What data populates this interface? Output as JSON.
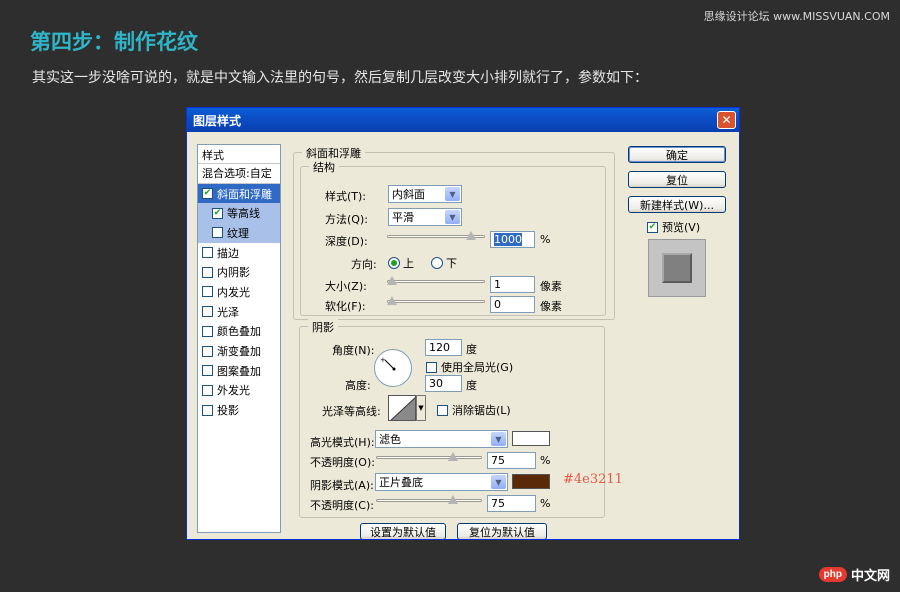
{
  "page": {
    "watermark": "思缘设计论坛 www.MISSVUAN.COM",
    "heading": "第四步：制作花纹",
    "intro": "其实这一步没啥可说的，就是中文输入法里的句号，然后复制几层改变大小排列就行了，参数如下：",
    "color_note": "#4e3211",
    "color_note_color": "#e05a4a",
    "logo_badge": "php",
    "logo_text": "中文网"
  },
  "dialog": {
    "title": "图层样式",
    "close": "✕",
    "styles_header": "样式",
    "blend_options": "混合选项:自定",
    "style_items": [
      {
        "label": "斜面和浮雕",
        "checked": true
      },
      {
        "label": "等高线",
        "checked": true
      },
      {
        "label": "纹理",
        "checked": false
      },
      {
        "label": "描边",
        "checked": false
      },
      {
        "label": "内阴影",
        "checked": false
      },
      {
        "label": "内发光",
        "checked": false
      },
      {
        "label": "光泽",
        "checked": false
      },
      {
        "label": "颜色叠加",
        "checked": false
      },
      {
        "label": "渐变叠加",
        "checked": false
      },
      {
        "label": "图案叠加",
        "checked": false
      },
      {
        "label": "外发光",
        "checked": false
      },
      {
        "label": "投影",
        "checked": false
      }
    ],
    "bevel": {
      "group_title": "斜面和浮雕",
      "structure_title": "结构",
      "style_label": "样式(T):",
      "style_value": "内斜面",
      "technique_label": "方法(Q):",
      "technique_value": "平滑",
      "depth_label": "深度(D):",
      "depth_value": "1000",
      "depth_unit": "%",
      "depth_fraction": 0.9,
      "direction_label": "方向:",
      "direction_up": "上",
      "direction_down": "下",
      "size_label": "大小(Z):",
      "size_value": "1",
      "size_unit": "像素",
      "size_fraction": 0.0,
      "soften_label": "软化(F):",
      "soften_value": "0",
      "soften_unit": "像素",
      "soften_fraction": 0.0
    },
    "shading": {
      "title": "阴影",
      "angle_label": "角度(N):",
      "angle_value": "120",
      "angle_unit": "度",
      "global_light_label": "使用全局光(G)",
      "altitude_label": "高度:",
      "altitude_value": "30",
      "altitude_unit": "度",
      "gloss_label": "光泽等高线:",
      "antialias_label": "消除锯齿(L)",
      "highlight_mode_label": "高光模式(H):",
      "highlight_mode_value": "滤色",
      "highlight_color": "#ffffff",
      "highlight_opacity_label": "不透明度(O):",
      "highlight_opacity_value": "75",
      "highlight_opacity_fraction": 0.75,
      "shadow_mode_label": "阴影模式(A):",
      "shadow_mode_value": "正片叠底",
      "shadow_color": "#5a2a08",
      "shadow_opacity_label": "不透明度(C):",
      "shadow_opacity_value": "75",
      "shadow_opacity_fraction": 0.75,
      "percent": "%"
    },
    "make_default": "设置为默认值",
    "reset_default": "复位为默认值",
    "ok": "确定",
    "reset": "复位",
    "new_style": "新建样式(W)...",
    "preview_label": "预览(V)"
  }
}
